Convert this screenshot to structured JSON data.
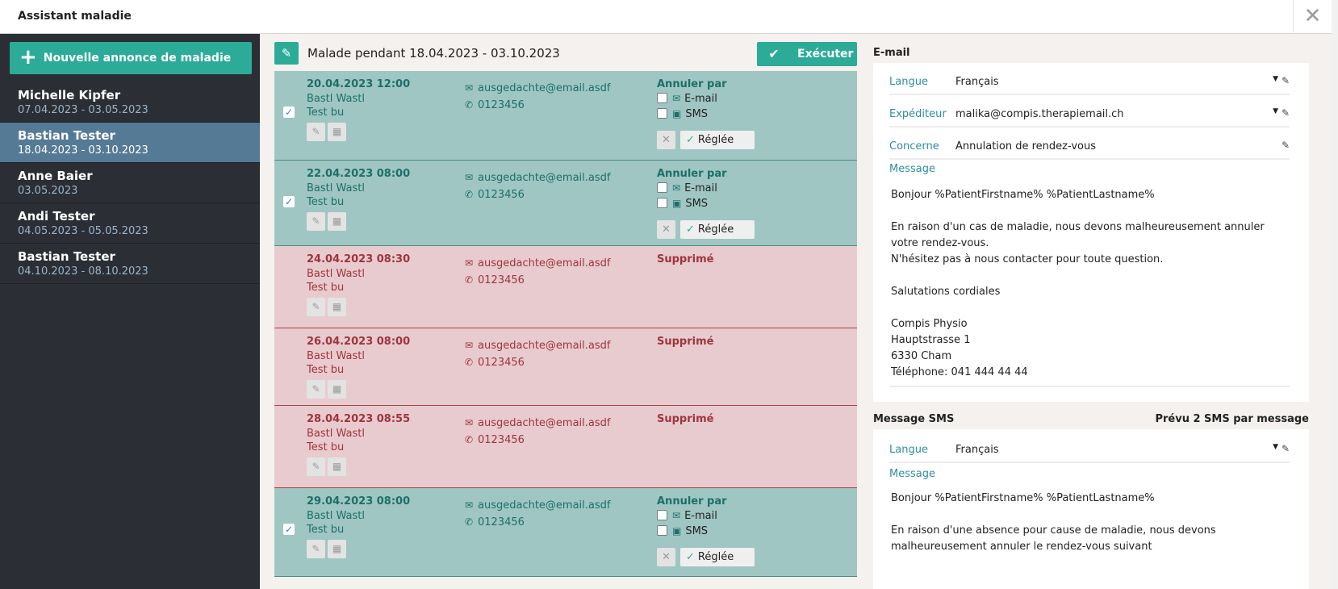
{
  "window": {
    "title": "Assistant maladie",
    "close_glyph": "✕"
  },
  "sidebar": {
    "new_button": {
      "icon": "plus-icon",
      "label": "Nouvelle annonce de maladie"
    },
    "items": [
      {
        "name": "Michelle Kipfer",
        "dates": "07.04.2023 - 03.05.2023",
        "active": false
      },
      {
        "name": "Bastian Tester",
        "dates": "18.04.2023 - 03.10.2023",
        "active": true
      },
      {
        "name": "Anne Baier",
        "dates": "03.05.2023",
        "active": false
      },
      {
        "name": "Andi Tester",
        "dates": "04.05.2023 - 05.05.2023",
        "active": false
      },
      {
        "name": "Bastian Tester",
        "dates": "04.10.2023 - 08.10.2023",
        "active": false
      }
    ]
  },
  "middle": {
    "title": "Malade pendant 18.04.2023 - 03.10.2023",
    "execute_label": "Exécuter",
    "appointments": [
      {
        "status": "ok",
        "datetime": "20.04.2023 12:00",
        "patient": "Bastl Wastl",
        "treatment": "Test bu",
        "email": "ausgedachte@email.asdf",
        "phone": "0123456",
        "cancel_by": "Annuler par",
        "opt_email": "E-mail",
        "opt_sms": "SMS",
        "done": "Réglée"
      },
      {
        "status": "ok",
        "datetime": "22.04.2023 08:00",
        "patient": "Bastl Wastl",
        "treatment": "Test bu",
        "email": "ausgedachte@email.asdf",
        "phone": "0123456",
        "cancel_by": "Annuler par",
        "opt_email": "E-mail",
        "opt_sms": "SMS",
        "done": "Réglée"
      },
      {
        "status": "del",
        "datetime": "24.04.2023 08:30",
        "patient": "Bastl Wastl",
        "treatment": "Test bu",
        "email": "ausgedachte@email.asdf",
        "phone": "0123456",
        "deleted": "Supprimé"
      },
      {
        "status": "del",
        "datetime": "26.04.2023 08:00",
        "patient": "Bastl Wastl",
        "treatment": "Test bu",
        "email": "ausgedachte@email.asdf",
        "phone": "0123456",
        "deleted": "Supprimé"
      },
      {
        "status": "del",
        "datetime": "28.04.2023 08:55",
        "patient": "Bastl Wastl",
        "treatment": "Test bu",
        "email": "ausgedachte@email.asdf",
        "phone": "0123456",
        "deleted": "Supprimé"
      },
      {
        "status": "ok",
        "datetime": "29.04.2023 08:00",
        "patient": "Bastl Wastl",
        "treatment": "Test bu",
        "email": "ausgedachte@email.asdf",
        "phone": "0123456",
        "cancel_by": "Annuler par",
        "opt_email": "E-mail",
        "opt_sms": "SMS",
        "done": "Réglée"
      }
    ]
  },
  "email": {
    "heading": "E-mail",
    "language_label": "Langue",
    "language_value": "Français",
    "sender_label": "Expéditeur",
    "sender_value": "malika@compis.therapiemail.ch",
    "subject_label": "Concerne",
    "subject_value": "Annulation de rendez-vous",
    "message_label": "Message",
    "message_lines": [
      "Bonjour %PatientFirstname% %PatientLastname%",
      "",
      "En raison d'un cas de maladie, nous devons malheureusement annuler votre rendez-vous.",
      "N'hésitez pas à nous contacter pour toute question.",
      "",
      "Salutations cordiales",
      "",
      "Compis Physio",
      "Hauptstrasse 1",
      "6330 Cham",
      "Téléphone: 041 444 44 44"
    ]
  },
  "sms": {
    "heading": "Message SMS",
    "note": "Prévu 2 SMS par message",
    "language_label": "Langue",
    "language_value": "Français",
    "message_label": "Message",
    "message_lines": [
      "Bonjour %PatientFirstname% %PatientLastname%",
      "",
      "En raison d'une absence pour cause de maladie, nous devons malheureusement annuler le rendez-vous suivant"
    ]
  },
  "colors": {
    "accent": "#2bab98",
    "sidebar_bg": "#2b2f35",
    "active_item": "#557a95",
    "ok_row": "#9fc6c2",
    "deleted_row": "#e8cbce"
  }
}
